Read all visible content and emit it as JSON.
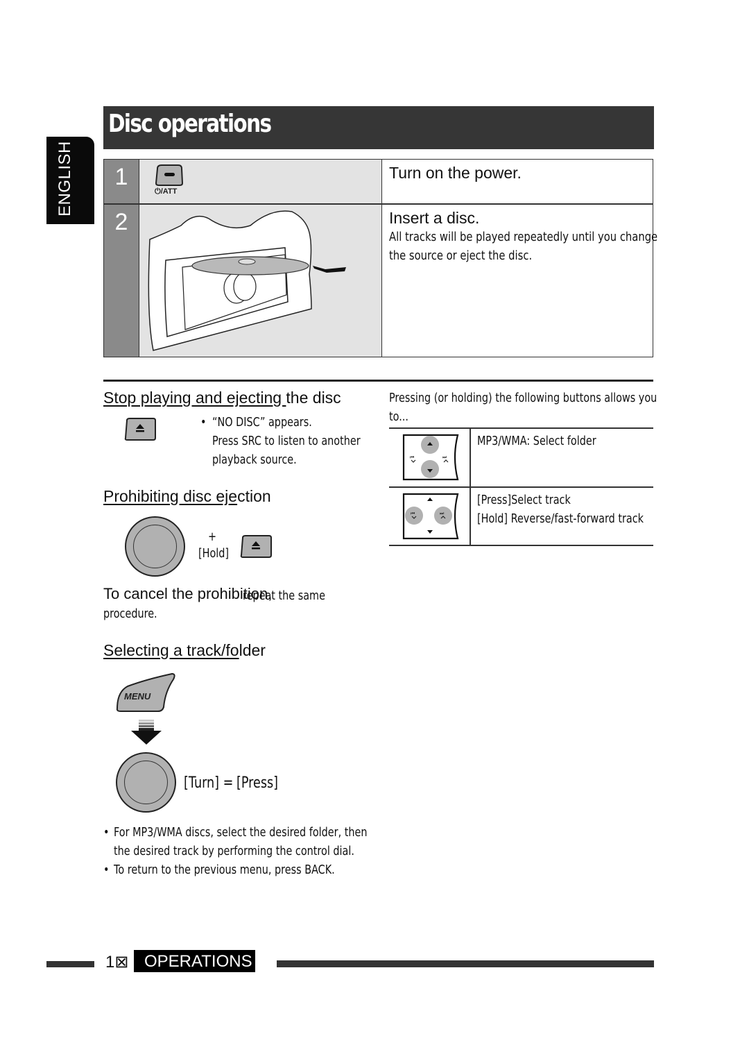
{
  "page": {
    "title": "Disc operations",
    "language_tab": "ENGLISH"
  },
  "steps": [
    {
      "number": "1",
      "button_label": "⏻/ATT",
      "button_icon": "power-att-button-icon",
      "heading": "Turn on the power.",
      "body": []
    },
    {
      "number": "2",
      "illustration": "disc-insert-illustration",
      "heading": "Insert a disc.",
      "body": [
        "All tracks will be played repeatedly until you change",
        "the source or eject the disc."
      ]
    }
  ],
  "stop_section": {
    "heading_underlined": "Stop playing and ejecting ",
    "heading_rest": "the disc",
    "button_icon": "eject-icon",
    "bullet": "•",
    "lines": [
      "“NO DISC” appears.",
      "Press SRC to listen to another",
      "playback source."
    ]
  },
  "prohibit_section": {
    "heading_underlined": "Prohibiting disc eje",
    "heading_rest": "ction",
    "plus": "+",
    "hold_label": "[Hold]",
    "cancel_large": "To cancel the prohibition,",
    "cancel_small": "repeat the same",
    "cancel_line2": "procedure."
  },
  "select_section": {
    "heading_underlined": "Selecting a track/fo",
    "heading_rest": "lder",
    "menu_label": "MENU",
    "turn_label": "[Turn] =",
    "press_label": "[Press]",
    "notes": [
      {
        "bullet": "•",
        "lines": [
          "For MP3/WMA discs, select the desired folder, then",
          "the desired track by performing the control dial."
        ]
      },
      {
        "bullet": "•",
        "lines": [
          "To return to the previous menu, press BACK."
        ]
      }
    ]
  },
  "right_panel": {
    "intro": [
      "Pressing (or holding) the following buttons allows you",
      "to..."
    ],
    "rows": [
      {
        "icon": "up-down-buttons-icon",
        "lines": [
          "MP3/WMA: Select folder"
        ]
      },
      {
        "icon": "prev-next-buttons-icon",
        "lines": [
          "[Press]Select track",
          "[Hold] Reverse/fast-forward track"
        ]
      }
    ]
  },
  "footer": {
    "page_number": "1⊠",
    "section": "OPERATIONS"
  },
  "colors": {
    "title_bar": "#363636",
    "step_number_bg": "#8a8a8a",
    "illustration_bg": "#e3e3e3",
    "button_fill": "#b1b1b1"
  }
}
